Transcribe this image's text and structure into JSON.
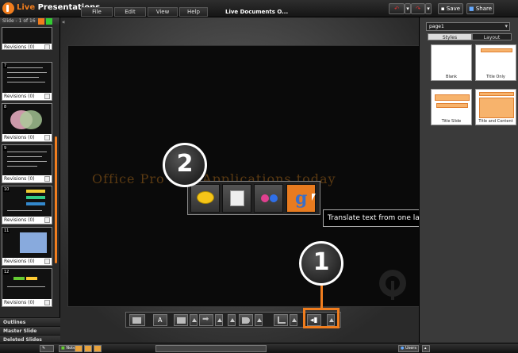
{
  "app": {
    "title_prefix": "Live",
    "title_suffix": " Presentations"
  },
  "menu": {
    "file": "File",
    "edit": "Edit",
    "view": "View",
    "help": "Help"
  },
  "document_title": "Live Documents  O...",
  "toolbar": {
    "save": "Save",
    "share": "Share"
  },
  "left_panel": {
    "header": "Slide - 1 of 16",
    "slides": [
      {
        "num": "7",
        "revisions": "Revisions (0)"
      },
      {
        "num": "8",
        "revisions": "Revisions (0)"
      },
      {
        "num": "9",
        "revisions": "Revisions (0)"
      },
      {
        "num": "10",
        "revisions": "Revisions (0)"
      },
      {
        "num": "11",
        "revisions": "Revisions (0)"
      },
      {
        "num": "12",
        "revisions": "Revisions (0)"
      }
    ],
    "first_revisions": "Revisions (0)",
    "sections": {
      "outlines": "Outlines",
      "master": "Master Slide",
      "deleted": "Deleted Slides"
    }
  },
  "slide": {
    "text": "Office Pro      uite Applications today"
  },
  "popup": {
    "tooltip": "Translate text from one language to another",
    "translate_glyph": "g"
  },
  "callouts": {
    "one": "1",
    "two": "2"
  },
  "right_panel": {
    "page_select": "page1",
    "tabs": {
      "styles": "Styles",
      "layout": "Layout"
    },
    "layouts": [
      "Blank",
      "Title Only",
      "Title Slide",
      "Title and Content"
    ]
  },
  "statusbar": {
    "notes": "Notes",
    "users": "Users"
  },
  "colors": {
    "accent": "#f07d1e",
    "background": "#1a1a1a"
  }
}
